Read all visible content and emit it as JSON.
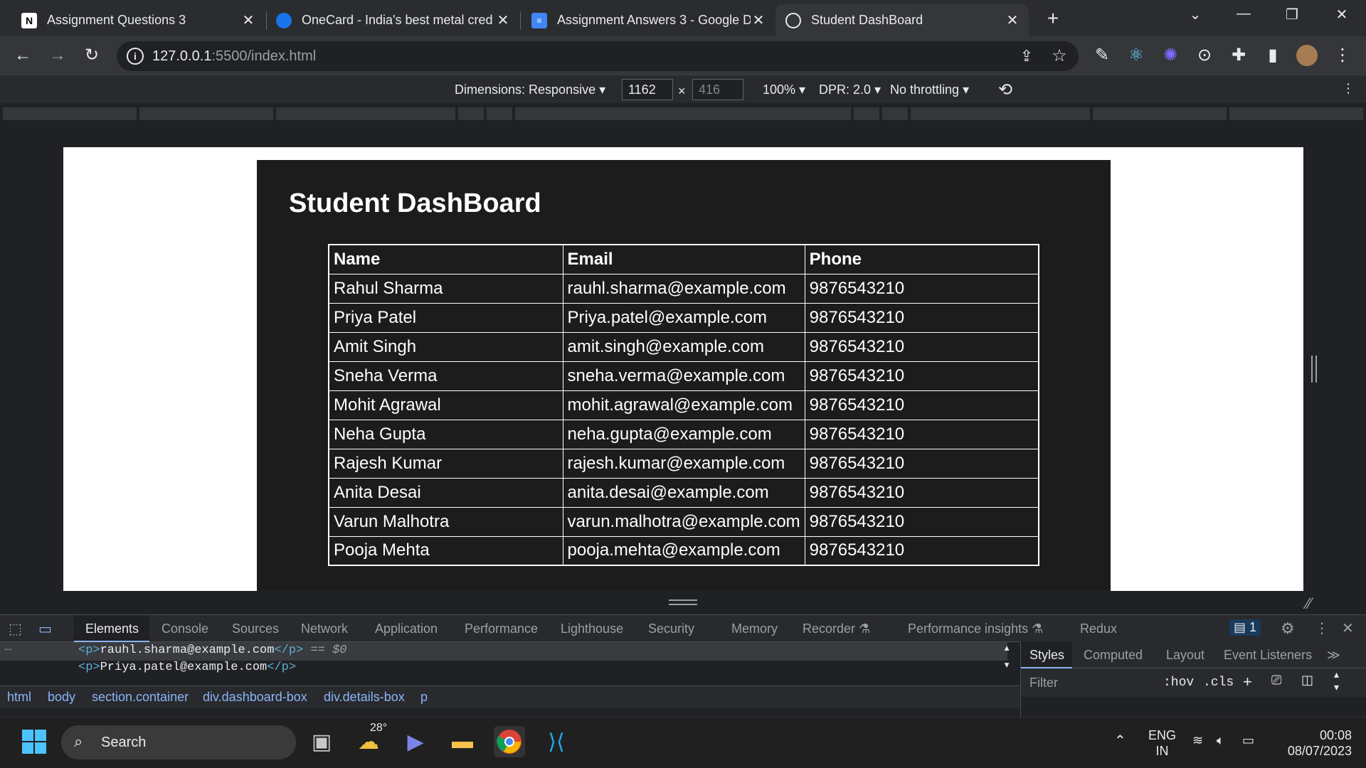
{
  "browser": {
    "tabs": [
      {
        "title": "Assignment Questions 3",
        "favicon": "notion-icon"
      },
      {
        "title": "OneCard - India's best metal cred",
        "favicon": "onecard-icon"
      },
      {
        "title": "Assignment Answers 3 - Google D",
        "favicon": "google-docs-icon"
      },
      {
        "title": "Student DashBoard",
        "favicon": "globe-icon"
      }
    ],
    "url_host": "127.0.0.1",
    "url_rest": ":5500/index.html"
  },
  "device_toolbar": {
    "dimensions_label": "Dimensions: Responsive",
    "width": "1162",
    "height": "416",
    "zoom": "100%",
    "dpr": "DPR: 2.0",
    "throttling": "No throttling"
  },
  "page": {
    "heading": "Student DashBoard",
    "columns": [
      "Name",
      "Email",
      "Phone"
    ],
    "rows": [
      [
        "Rahul Sharma",
        "rauhl.sharma@example.com",
        "9876543210"
      ],
      [
        "Priya Patel",
        "Priya.patel@example.com",
        "9876543210"
      ],
      [
        "Amit Singh",
        "amit.singh@example.com",
        "9876543210"
      ],
      [
        "Sneha Verma",
        "sneha.verma@example.com",
        "9876543210"
      ],
      [
        "Mohit Agrawal",
        "mohit.agrawal@example.com",
        "9876543210"
      ],
      [
        "Neha Gupta",
        "neha.gupta@example.com",
        "9876543210"
      ],
      [
        "Rajesh Kumar",
        "rajesh.kumar@example.com",
        "9876543210"
      ],
      [
        "Anita Desai",
        "anita.desai@example.com",
        "9876543210"
      ],
      [
        "Varun Malhotra",
        "varun.malhotra@example.com",
        "9876543210"
      ],
      [
        "Pooja Mehta",
        "pooja.mehta@example.com",
        "9876543210"
      ]
    ]
  },
  "devtools": {
    "tabs": [
      "Elements",
      "Console",
      "Sources",
      "Network",
      "Application",
      "Performance",
      "Lighthouse",
      "Security",
      "Memory",
      "Recorder",
      "Performance insights",
      "Redux"
    ],
    "issues_count": "1",
    "dom_lines": [
      {
        "open": "<p>",
        "text": "rauhl.sharma@example.com",
        "close": "</p>",
        "suffix": "== $0"
      },
      {
        "open": "<p>",
        "text": "Priya.patel@example.com",
        "close": "</p>",
        "suffix": ""
      }
    ],
    "breadcrumbs": [
      "html",
      "body",
      "section.container",
      "div.dashboard-box",
      "div.details-box",
      "p"
    ],
    "styles_tabs": [
      "Styles",
      "Computed",
      "Layout",
      "Event Listeners"
    ],
    "filter_placeholder": "Filter",
    "hov": ":hov",
    "cls": ".cls"
  },
  "taskbar": {
    "search_label": "Search",
    "weather_temp": "28°",
    "lang_line1": "ENG",
    "lang_line2": "IN",
    "time": "00:08",
    "date": "08/07/2023"
  },
  "colors": {
    "page_bg": "#ffffff",
    "dashboard_bg": "#1c1c1c",
    "devtools_accent": "#8ab4f8"
  }
}
